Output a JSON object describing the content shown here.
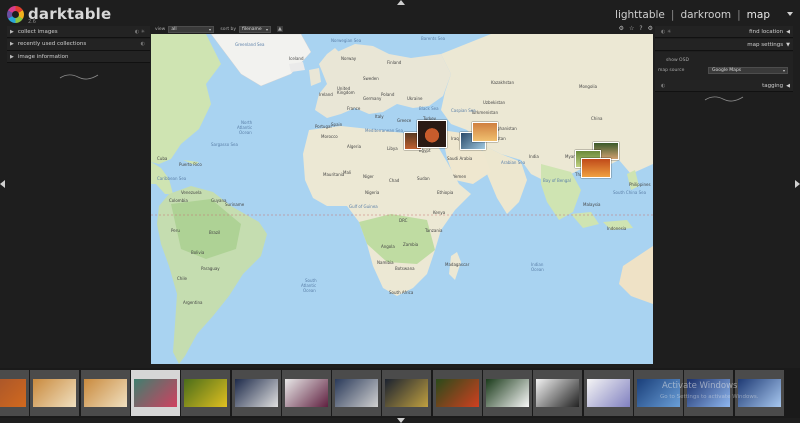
{
  "app": {
    "name": "darktable",
    "version_sub": "2.6"
  },
  "views": {
    "lighttable": "lighttable",
    "darkroom": "darkroom",
    "map": "map",
    "sep": "|"
  },
  "left_panel": {
    "modules": [
      {
        "label": "collect images",
        "icons": "◐ ✳"
      },
      {
        "label": "recently used collections",
        "icons": "◐"
      },
      {
        "label": "image information",
        "icons": ""
      }
    ]
  },
  "toolbar": {
    "view_label": "view",
    "view_value": "all",
    "sort_label": "sort by",
    "sort_value": "filename",
    "sort_dir": "▲",
    "right_icons": [
      "gear-icon",
      "star-icon",
      "help-icon",
      "settings-icon"
    ]
  },
  "right_panel": {
    "find_location": "find location",
    "map_settings": "map settings",
    "show_osd": "show OSD",
    "map_source_label": "map source",
    "map_source_value": "Google Maps",
    "tagging": "tagging"
  },
  "map_labels": {
    "countries": [
      "Iceland",
      "Sweden",
      "Finland",
      "Norway",
      "United Kingdom",
      "Ireland",
      "Poland",
      "Germany",
      "France",
      "Ukraine",
      "Spain",
      "Portugal",
      "Italy",
      "Turkey",
      "Algeria",
      "Libya",
      "Egypt",
      "Mali",
      "Niger",
      "Chad",
      "Sudan",
      "Nigeria",
      "Morocco",
      "Mauritania",
      "Ethiopia",
      "Kenya",
      "DRC",
      "Tanzania",
      "Angola",
      "Zambia",
      "Namibia",
      "Botswana",
      "South Africa",
      "Madagascar",
      "Saudi Arabia",
      "Yemen",
      "Iraq",
      "Iran",
      "Afghanistan",
      "Pakistan",
      "Kazakhstan",
      "Turkmenistan",
      "Mongolia",
      "China",
      "India",
      "Myanmar",
      "Thailand",
      "Philippines",
      "Malaysia",
      "Indonesia",
      "Greece",
      "Syria",
      "Brazil",
      "Peru",
      "Bolivia",
      "Colombia",
      "Venezuela",
      "Argentina",
      "Chile",
      "Paraguay",
      "Uzbekistan",
      "Cuba",
      "Puerto Rico",
      "Guyana",
      "Suriname"
    ],
    "oceans": [
      "North Atlantic Ocean",
      "South Atlantic Ocean",
      "Indian Ocean",
      "Arabian Sea",
      "Bay of Bengal",
      "Caribbean Sea",
      "Gulf of Guinea",
      "South China Sea",
      "Norwegian Sea",
      "Greenland Sea",
      "Barents Sea",
      "Caspian Sea",
      "Black Sea",
      "Mediterranean Sea",
      "Sargasso Sea"
    ]
  },
  "filmstrip": {
    "frames": [
      {
        "name": "frame-orange",
        "colors": [
          "#a0522d",
          "#d2691e"
        ]
      },
      {
        "name": "frame-dog-1",
        "colors": [
          "#c98a3e",
          "#f0e0c0"
        ]
      },
      {
        "name": "frame-dog-2",
        "colors": [
          "#c98a3e",
          "#f0e0c0"
        ]
      },
      {
        "name": "frame-child",
        "colors": [
          "#3f7f6f",
          "#d04060"
        ]
      },
      {
        "name": "frame-yellow-flower",
        "colors": [
          "#4a6d1a",
          "#e0c020"
        ]
      },
      {
        "name": "frame-panel-1",
        "colors": [
          "#1d2a4a",
          "#e0e0e0"
        ]
      },
      {
        "name": "frame-panorama",
        "colors": [
          "#e8e8e8",
          "#602040"
        ]
      },
      {
        "name": "frame-panel-2",
        "colors": [
          "#2a3a5a",
          "#d0d0d0"
        ]
      },
      {
        "name": "frame-night",
        "colors": [
          "#1b2230",
          "#c0a040"
        ]
      },
      {
        "name": "frame-flowers",
        "colors": [
          "#2a4a1a",
          "#d04020"
        ]
      },
      {
        "name": "frame-daisy",
        "colors": [
          "#1a3a1a",
          "#f8f8f8"
        ]
      },
      {
        "name": "frame-lens",
        "colors": [
          "#f2f2f2",
          "#222222"
        ]
      },
      {
        "name": "frame-screenshot",
        "colors": [
          "#f5f5f5",
          "#8080c0"
        ]
      },
      {
        "name": "frame-blue-1",
        "colors": [
          "#1a3f7a",
          "#6a9fd8"
        ]
      },
      {
        "name": "frame-blue-2",
        "colors": [
          "#1a2f6a",
          "#90b8f0"
        ]
      },
      {
        "name": "frame-blue-3",
        "colors": [
          "#1e3a74",
          "#a8c8f0"
        ]
      }
    ]
  },
  "watermark": {
    "title": "Activate Windows",
    "subtitle": "Go to Settings to activate Windows."
  }
}
